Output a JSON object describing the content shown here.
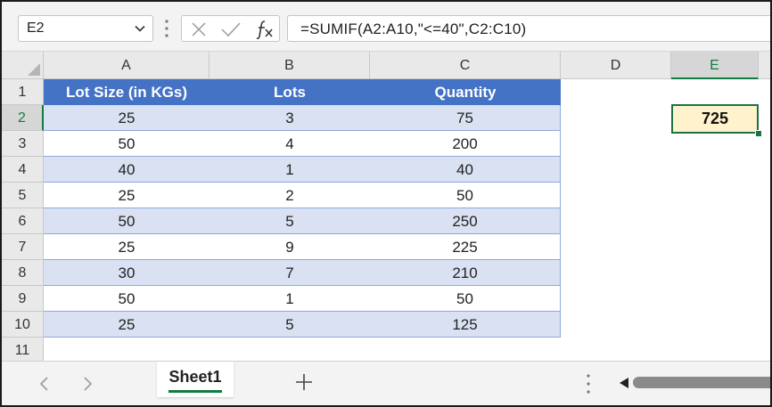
{
  "formula_bar": {
    "name_box": "E2",
    "formula": "=SUMIF(A2:A10,\"<=40\",C2:C10)"
  },
  "columns": [
    "A",
    "B",
    "C",
    "D",
    "E"
  ],
  "rows": [
    "1",
    "2",
    "3",
    "4",
    "5",
    "6",
    "7",
    "8",
    "9",
    "10",
    "11"
  ],
  "table": {
    "headers": [
      "Lot Size (in KGs)",
      "Lots",
      "Quantity"
    ],
    "data": [
      [
        "25",
        "3",
        "75"
      ],
      [
        "50",
        "4",
        "200"
      ],
      [
        "40",
        "1",
        "40"
      ],
      [
        "25",
        "2",
        "50"
      ],
      [
        "50",
        "5",
        "250"
      ],
      [
        "25",
        "9",
        "225"
      ],
      [
        "30",
        "7",
        "210"
      ],
      [
        "50",
        "1",
        "50"
      ],
      [
        "25",
        "5",
        "125"
      ]
    ]
  },
  "result_cell": "725",
  "sheet_tabs": {
    "active": "Sheet1"
  },
  "colors": {
    "header_fill": "#4472c4",
    "band_fill": "#d9e1f2",
    "result_fill": "#fff2cc",
    "selection": "#1e7145"
  }
}
